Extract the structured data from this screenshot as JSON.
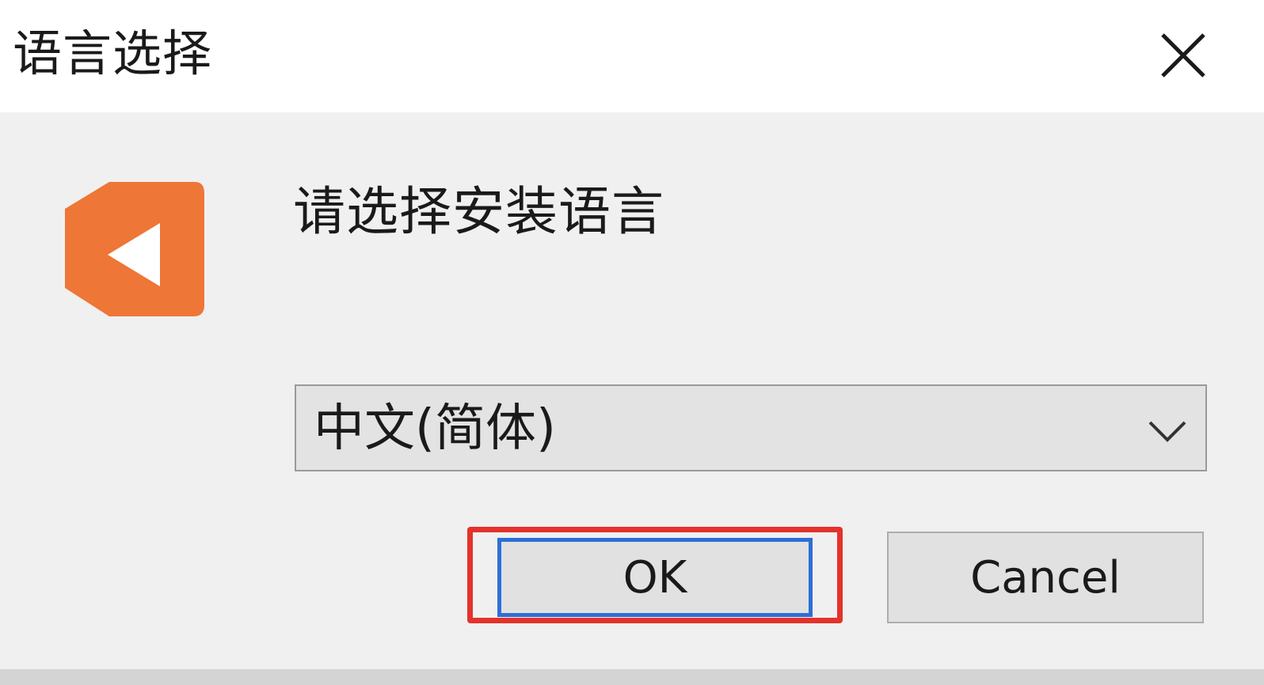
{
  "window": {
    "title": "语言选择",
    "close_icon": "close-icon"
  },
  "content": {
    "logo_icon": "app-logo",
    "prompt": "请选择安装语言",
    "language_select": {
      "value": "中文(简体)",
      "arrow_icon": "chevron-down-icon"
    }
  },
  "buttons": {
    "ok_label": "OK",
    "cancel_label": "Cancel"
  },
  "colors": {
    "logo": "#ee7637",
    "highlight": "#e4322b",
    "focus": "#2d6fd8"
  }
}
